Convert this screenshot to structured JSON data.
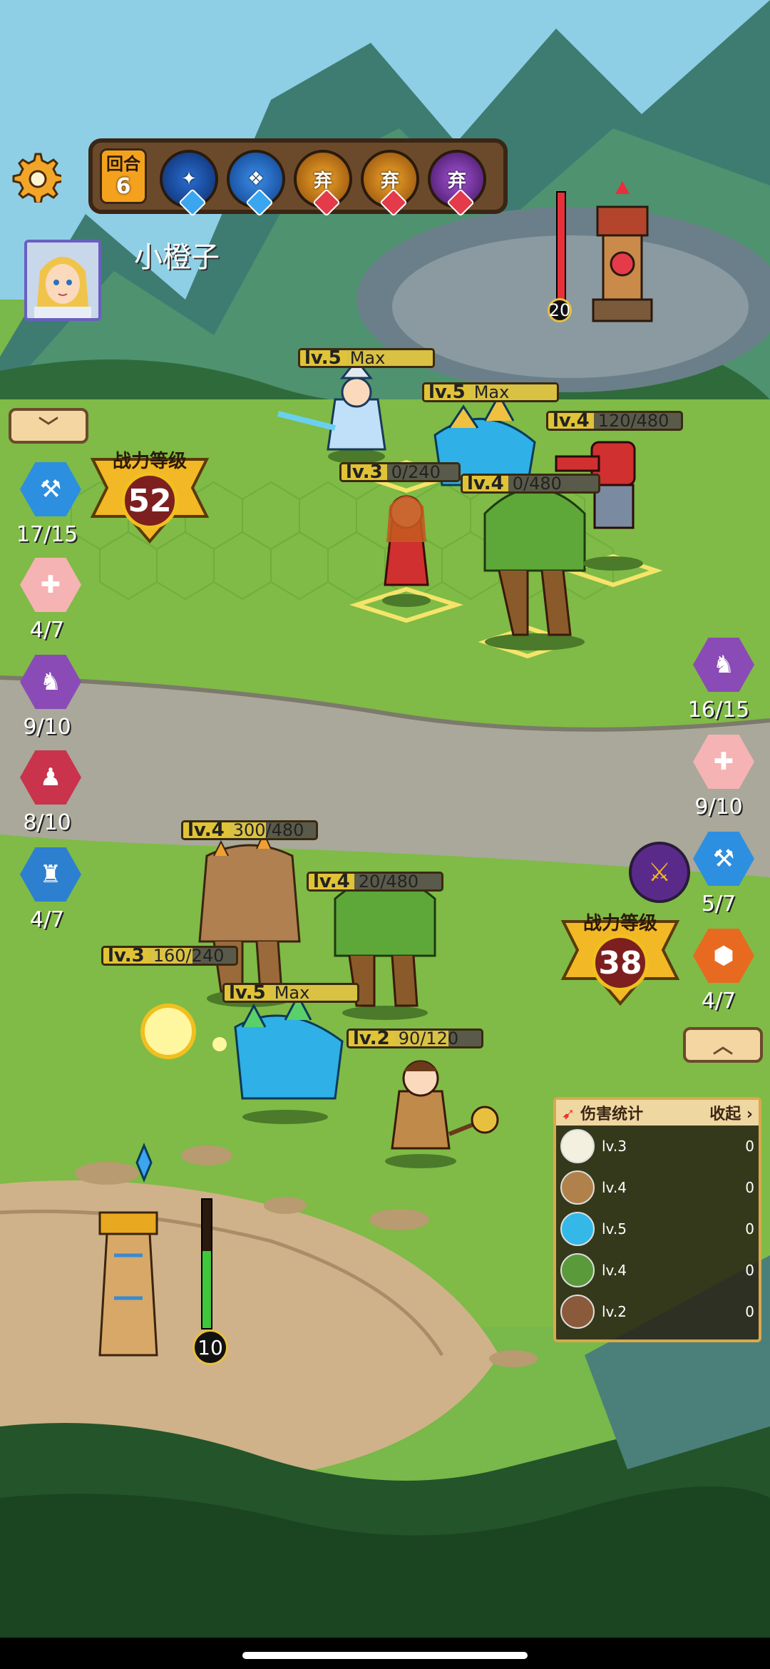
{
  "player": {
    "name": "小橙子"
  },
  "round": {
    "label": "回合",
    "number": "6"
  },
  "cards": [
    {
      "icon": "water-card-icon",
      "text": "",
      "gem": "blue"
    },
    {
      "icon": "ice-card-icon",
      "text": "",
      "gem": "blue"
    },
    {
      "icon": "discard-card-icon",
      "text": "弃",
      "gem": "red"
    },
    {
      "icon": "discard-card-icon",
      "text": "弃",
      "gem": "red"
    },
    {
      "icon": "discard-card-icon",
      "text": "弃",
      "gem": "red"
    }
  ],
  "enemy_tower": {
    "hp": "20",
    "bar_fraction": 1.0
  },
  "player_tower": {
    "hp": "10",
    "bar_fraction": 0.6
  },
  "power": {
    "label": "战力等级",
    "player": "52",
    "enemy": "38"
  },
  "left_traits": [
    {
      "count": "17/15",
      "color": "#2d8fe0"
    },
    {
      "count": "4/7",
      "color": "#f5b3b3"
    },
    {
      "count": "9/10",
      "color": "#8a4bb7"
    },
    {
      "count": "8/10",
      "color": "#c9334b"
    },
    {
      "count": "4/7",
      "color": "#2d7fd0"
    }
  ],
  "right_traits": [
    {
      "count": "16/15",
      "color": "#8a4bb7"
    },
    {
      "count": "9/10",
      "color": "#f5b3b3"
    },
    {
      "count": "5/7",
      "color": "#2d8fe0"
    },
    {
      "count": "4/7",
      "color": "#e86a20"
    }
  ],
  "unit_bars": [
    {
      "lv": "lv.5",
      "val": "Max",
      "fill": 1.0
    },
    {
      "lv": "lv.5",
      "val": "Max",
      "fill": 1.0
    },
    {
      "lv": "lv.4",
      "val": "120/480",
      "fill": 0.25
    },
    {
      "lv": "lv.3",
      "val": "0/240",
      "fill": 0.0
    },
    {
      "lv": "lv.4",
      "val": "0/480",
      "fill": 0.0
    },
    {
      "lv": "lv.4",
      "val": "300/480",
      "fill": 0.625
    },
    {
      "lv": "lv.4",
      "val": "20/480",
      "fill": 0.04
    },
    {
      "lv": "lv.3",
      "val": "160/240",
      "fill": 0.67
    },
    {
      "lv": "lv.5",
      "val": "Max",
      "fill": 1.0
    },
    {
      "lv": "lv.2",
      "val": "90/120",
      "fill": 0.75
    }
  ],
  "damage_panel": {
    "title": "伤害统计",
    "collapse": "收起",
    "rows": [
      {
        "lv": "lv.3",
        "value": "0",
        "color": "#f4f0e0"
      },
      {
        "lv": "lv.4",
        "value": "0",
        "color": "#b0814a"
      },
      {
        "lv": "lv.5",
        "value": "0",
        "color": "#34b8e8"
      },
      {
        "lv": "lv.4",
        "value": "0",
        "color": "#5a9a3a"
      },
      {
        "lv": "lv.2",
        "value": "0",
        "color": "#8a5a3a"
      }
    ]
  }
}
